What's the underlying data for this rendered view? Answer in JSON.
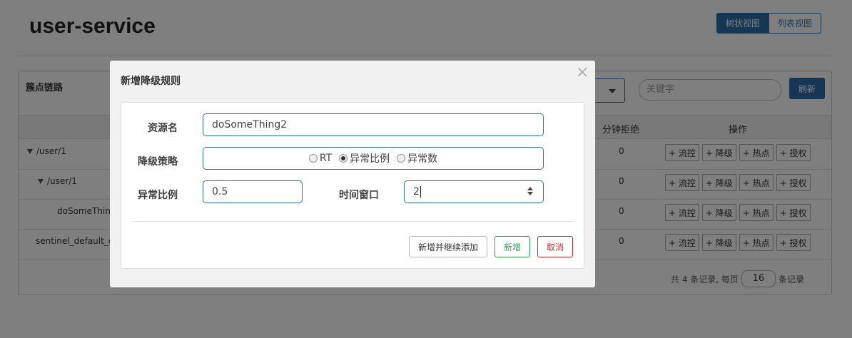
{
  "page": {
    "title": "user-service",
    "view_tree": "树状视图",
    "view_list": "列表视图"
  },
  "panel": {
    "title": "簇点链路",
    "search_placeholder": "关键字",
    "refresh": "刷新",
    "columns": {
      "rejected_per_min": "分钟拒绝",
      "actions": "操作"
    },
    "rows": [
      {
        "name": "/user/1",
        "value": "0"
      },
      {
        "name": "/user/1",
        "value": "0"
      },
      {
        "name": "doSomeThing",
        "value": "0"
      },
      {
        "name": "sentinel_default_co",
        "value": "0"
      }
    ],
    "op_buttons": [
      "+ 流控",
      "+ 降级",
      "+ 热点",
      "+ 授权"
    ],
    "pager": {
      "prefix": "共 4 条记录, 每页",
      "page_size": "16",
      "suffix": "条记录"
    }
  },
  "modal": {
    "title": "新增降级规则",
    "close": "×",
    "resource_label": "资源名",
    "resource_value": "doSomeThing2",
    "strategy_label": "降级策略",
    "strategies": [
      "RT",
      "异常比例",
      "异常数"
    ],
    "selected_strategy": "异常比例",
    "ratio_label": "异常比例",
    "ratio_value": "0.5",
    "window_label": "时间窗口",
    "window_value": "2",
    "btn_add_continue": "新增并继续添加",
    "btn_add": "新增",
    "btn_cancel": "取消"
  }
}
